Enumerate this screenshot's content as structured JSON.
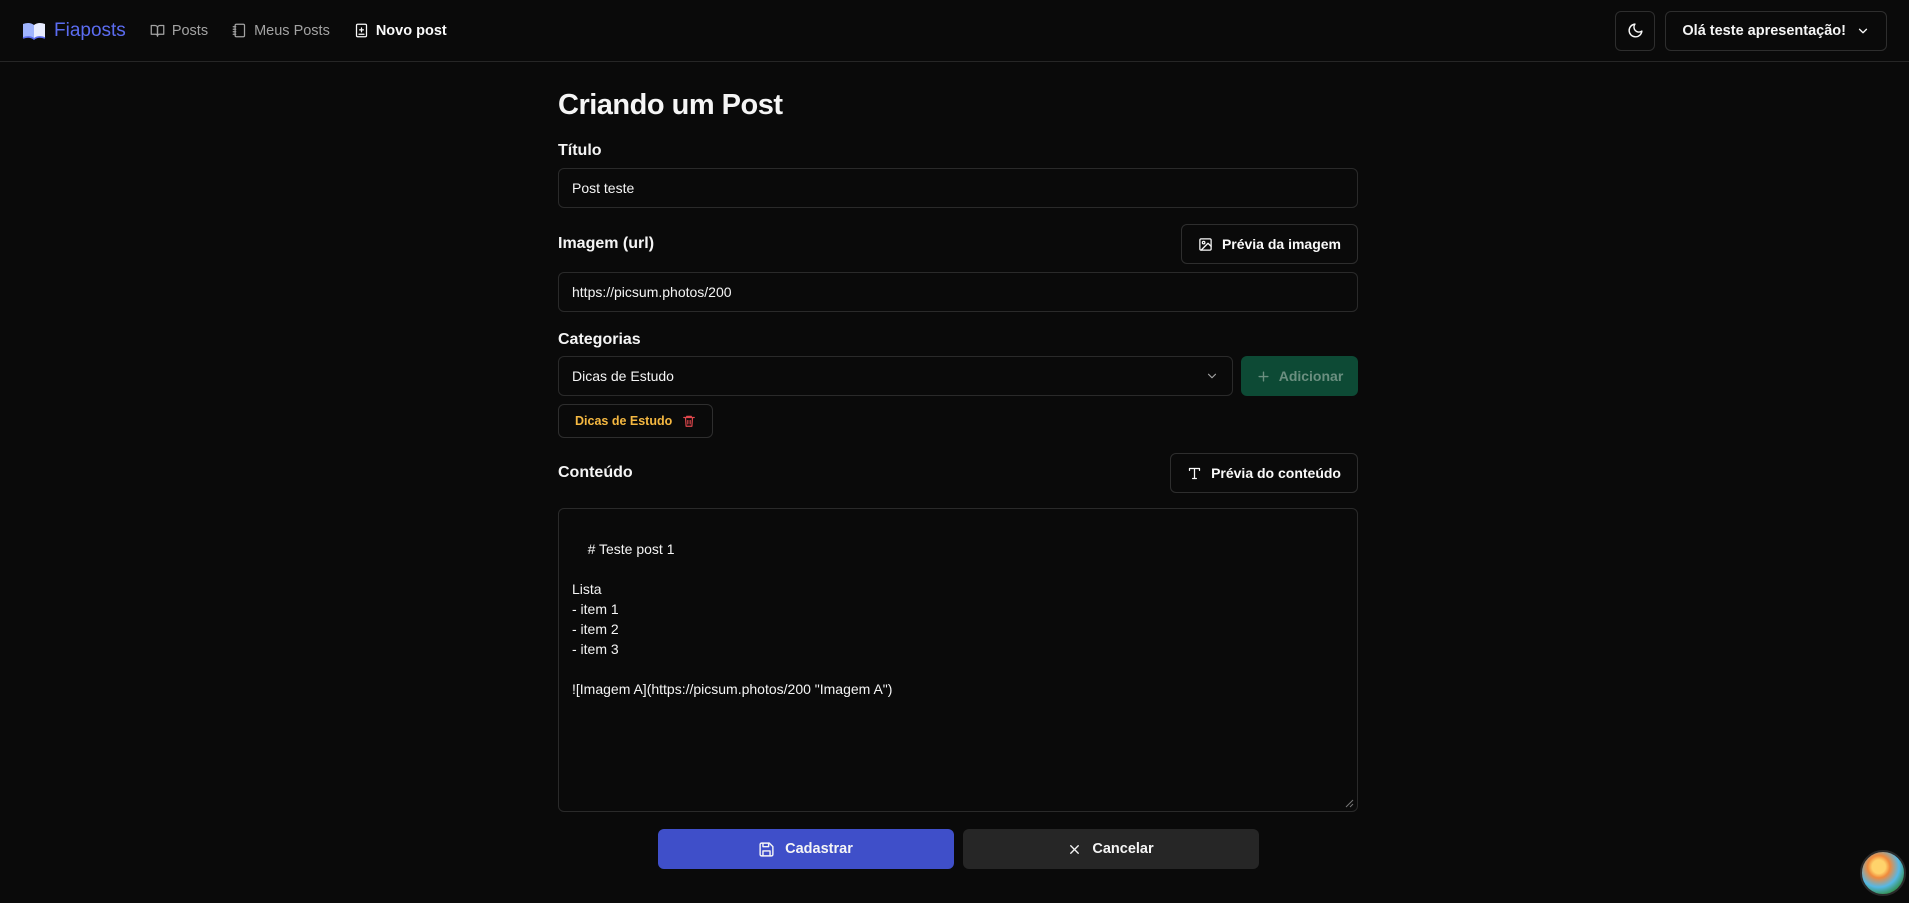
{
  "nav": {
    "brand": "Fiaposts",
    "links": [
      {
        "label": "Posts",
        "icon": "book-open-icon"
      },
      {
        "label": "Meus Posts",
        "icon": "notebook-icon"
      },
      {
        "label": "Novo post",
        "icon": "file-plus-icon",
        "active": true
      }
    ],
    "user_label": "Olá teste apresentação!"
  },
  "page": {
    "title": "Criando um Post"
  },
  "form": {
    "title_label": "Título",
    "title_value": "Post teste",
    "image_label": "Imagem (url)",
    "image_preview_button": "Prévia da imagem",
    "image_value": "https://picsum.photos/200",
    "categories_label": "Categorias",
    "category_select_value": "Dicas de Estudo",
    "add_button": "Adicionar",
    "selected_categories": [
      "Dicas de Estudo"
    ],
    "content_label": "Conteúdo",
    "content_preview_button": "Prévia do conteúdo",
    "content_value": "# Teste post 1\n\nLista\n- item 1\n- item 2\n- item 3\n\n![Imagem A](https://picsum.photos/200 \"Imagem A\")",
    "submit_button": "Cadastrar",
    "cancel_button": "Cancelar"
  },
  "colors": {
    "brand": "#5b6cf0",
    "primary": "#3f4fc9",
    "add_button_bg": "#0d4a35",
    "chip_text": "#f5b841",
    "background": "#0a0a0a"
  }
}
